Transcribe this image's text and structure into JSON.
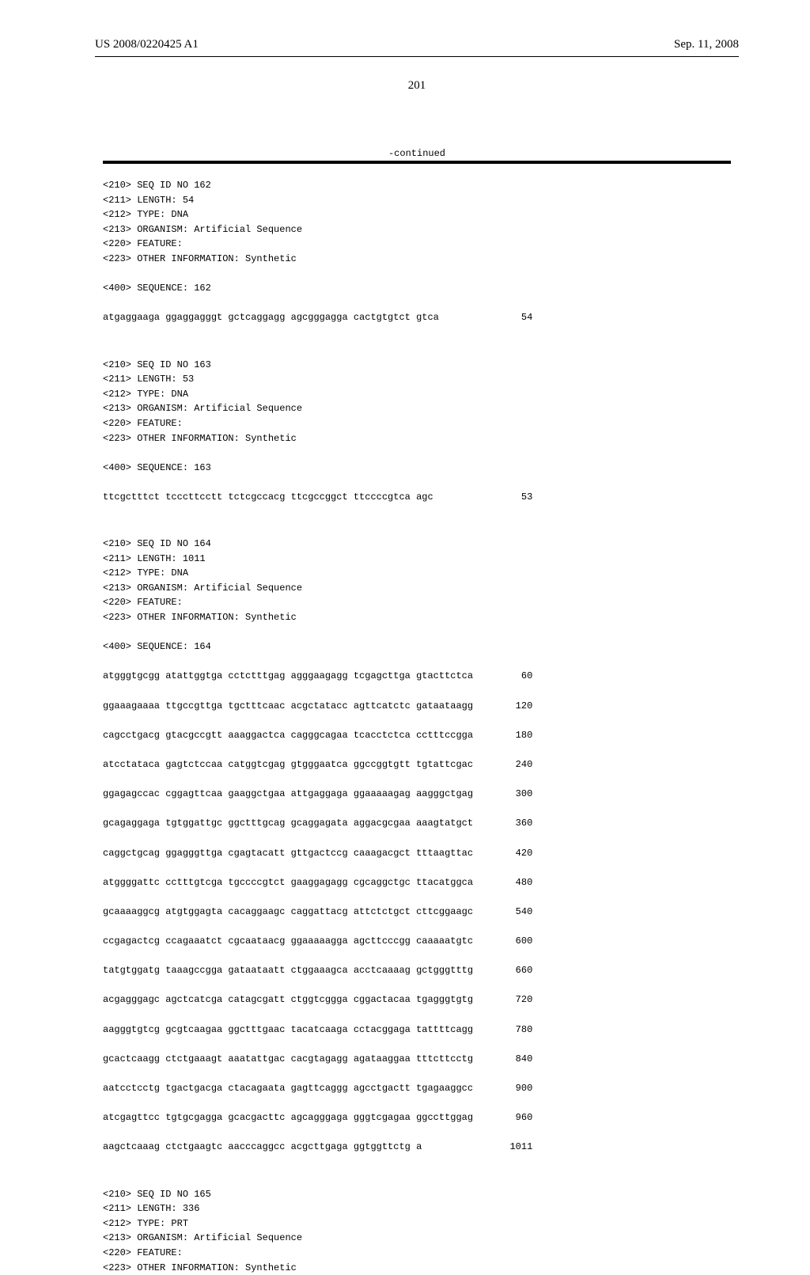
{
  "header": {
    "left": "US 2008/0220425 A1",
    "right": "Sep. 11, 2008"
  },
  "page_number": "201",
  "continued": "-continued",
  "entries": [
    {
      "meta": [
        "<210> SEQ ID NO 162",
        "<211> LENGTH: 54",
        "<212> TYPE: DNA",
        "<213> ORGANISM: Artificial Sequence",
        "<220> FEATURE:",
        "<223> OTHER INFORMATION: Synthetic"
      ],
      "seq_header": "<400> SEQUENCE: 162",
      "lines": [
        {
          "g": [
            "atgaggaaga",
            "ggaggagggt",
            "gctcaggagg",
            "agcgggagga",
            "cactgtgtct",
            "gtca"
          ],
          "n": "54"
        }
      ]
    },
    {
      "meta": [
        "<210> SEQ ID NO 163",
        "<211> LENGTH: 53",
        "<212> TYPE: DNA",
        "<213> ORGANISM: Artificial Sequence",
        "<220> FEATURE:",
        "<223> OTHER INFORMATION: Synthetic"
      ],
      "seq_header": "<400> SEQUENCE: 163",
      "lines": [
        {
          "g": [
            "ttcgctttct",
            "tcccttcctt",
            "tctcgccacg",
            "ttcgccggct",
            "ttccccgtca",
            "agc"
          ],
          "n": "53"
        }
      ]
    },
    {
      "meta": [
        "<210> SEQ ID NO 164",
        "<211> LENGTH: 1011",
        "<212> TYPE: DNA",
        "<213> ORGANISM: Artificial Sequence",
        "<220> FEATURE:",
        "<223> OTHER INFORMATION: Synthetic"
      ],
      "seq_header": "<400> SEQUENCE: 164",
      "lines": [
        {
          "g": [
            "atgggtgcgg",
            "atattggtga",
            "cctctttgag",
            "agggaagagg",
            "tcgagcttga",
            "gtacttctca"
          ],
          "n": "60"
        },
        {
          "g": [
            "ggaaagaaaa",
            "ttgccgttga",
            "tgctttcaac",
            "acgctatacc",
            "agttcatctc",
            "gataataagg"
          ],
          "n": "120"
        },
        {
          "g": [
            "cagcctgacg",
            "gtacgccgtt",
            "aaaggactca",
            "cagggcagaa",
            "tcacctctca",
            "cctttccgga"
          ],
          "n": "180"
        },
        {
          "g": [
            "atcctataca",
            "gagtctccaa",
            "catggtcgag",
            "gtgggaatca",
            "ggccggtgtt",
            "tgtattcgac"
          ],
          "n": "240"
        },
        {
          "g": [
            "ggagagccac",
            "cggagttcaa",
            "gaaggctgaa",
            "attgaggaga",
            "ggaaaaagag",
            "aagggctgag"
          ],
          "n": "300"
        },
        {
          "g": [
            "gcagaggaga",
            "tgtggattgc",
            "ggctttgcag",
            "gcaggagata",
            "aggacgcgaa",
            "aaagtatgct"
          ],
          "n": "360"
        },
        {
          "g": [
            "caggctgcag",
            "ggagggttga",
            "cgagtacatt",
            "gttgactccg",
            "caaagacgct",
            "tttaagttac"
          ],
          "n": "420"
        },
        {
          "g": [
            "atggggattc",
            "cctttgtcga",
            "tgccccgtct",
            "gaaggagagg",
            "cgcaggctgc",
            "ttacatggca"
          ],
          "n": "480"
        },
        {
          "g": [
            "gcaaaaggcg",
            "atgtggagta",
            "cacaggaagc",
            "caggattacg",
            "attctctgct",
            "cttcggaagc"
          ],
          "n": "540"
        },
        {
          "g": [
            "ccgagactcg",
            "ccagaaatct",
            "cgcaataacg",
            "ggaaaaagga",
            "agcttcccgg",
            "caaaaatgtc"
          ],
          "n": "600"
        },
        {
          "g": [
            "tatgtggatg",
            "taaagccgga",
            "gataataatt",
            "ctggaaagca",
            "acctcaaaag",
            "gctgggtttg"
          ],
          "n": "660"
        },
        {
          "g": [
            "acgagggagc",
            "agctcatcga",
            "catagcgatt",
            "ctggtcggga",
            "cggactacaa",
            "tgagggtgtg"
          ],
          "n": "720"
        },
        {
          "g": [
            "aagggtgtcg",
            "gcgtcaagaa",
            "ggctttgaac",
            "tacatcaaga",
            "cctacggaga",
            "tattttcagg"
          ],
          "n": "780"
        },
        {
          "g": [
            "gcactcaagg",
            "ctctgaaagt",
            "aaatattgac",
            "cacgtagagg",
            "agataaggaa",
            "tttcttcctg"
          ],
          "n": "840"
        },
        {
          "g": [
            "aatcctcctg",
            "tgactgacga",
            "ctacagaata",
            "gagttcaggg",
            "agcctgactt",
            "tgagaaggcc"
          ],
          "n": "900"
        },
        {
          "g": [
            "atcgagttcc",
            "tgtgcgagga",
            "gcacgacttc",
            "agcagggaga",
            "gggtcgagaa",
            "ggccttggag"
          ],
          "n": "960"
        },
        {
          "g": [
            "aagctcaaag",
            "ctctgaagtc",
            "aacccaggcc",
            "acgcttgaga",
            "ggtggttctg",
            "a"
          ],
          "n": "1011"
        }
      ]
    },
    {
      "meta": [
        "<210> SEQ ID NO 165",
        "<211> LENGTH: 336",
        "<212> TYPE: PRT",
        "<213> ORGANISM: Artificial Sequence",
        "<220> FEATURE:",
        "<223> OTHER INFORMATION: Synthetic"
      ],
      "seq_header": "",
      "lines": []
    }
  ]
}
